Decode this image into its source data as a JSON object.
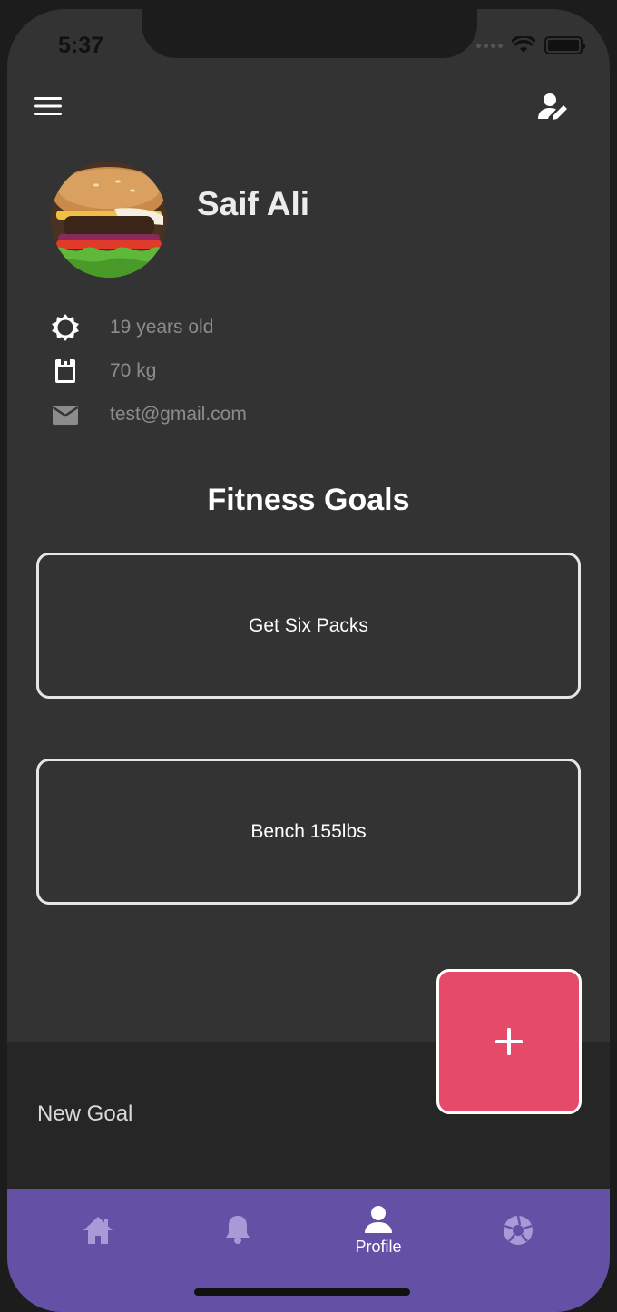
{
  "status_bar": {
    "time": "5:37"
  },
  "profile": {
    "name": "Saif Ali",
    "age": "19 years old",
    "weight": "70 kg",
    "email": "test@gmail.com"
  },
  "goals_section": {
    "title": "Fitness Goals",
    "goals": [
      "Get Six Packs",
      "Bench 155lbs"
    ]
  },
  "new_goal": {
    "label": "New Goal",
    "button_symbol": "+"
  },
  "tab_bar": {
    "tabs": [
      {
        "icon": "home-icon",
        "label": ""
      },
      {
        "icon": "bell-icon",
        "label": ""
      },
      {
        "icon": "person-icon",
        "label": "Profile",
        "active": true
      },
      {
        "icon": "aperture-icon",
        "label": ""
      }
    ]
  },
  "colors": {
    "background": "#333333",
    "accent_purple": "#6451a6",
    "fab_pink": "#e54b69",
    "muted_text": "#8c8c8c"
  }
}
